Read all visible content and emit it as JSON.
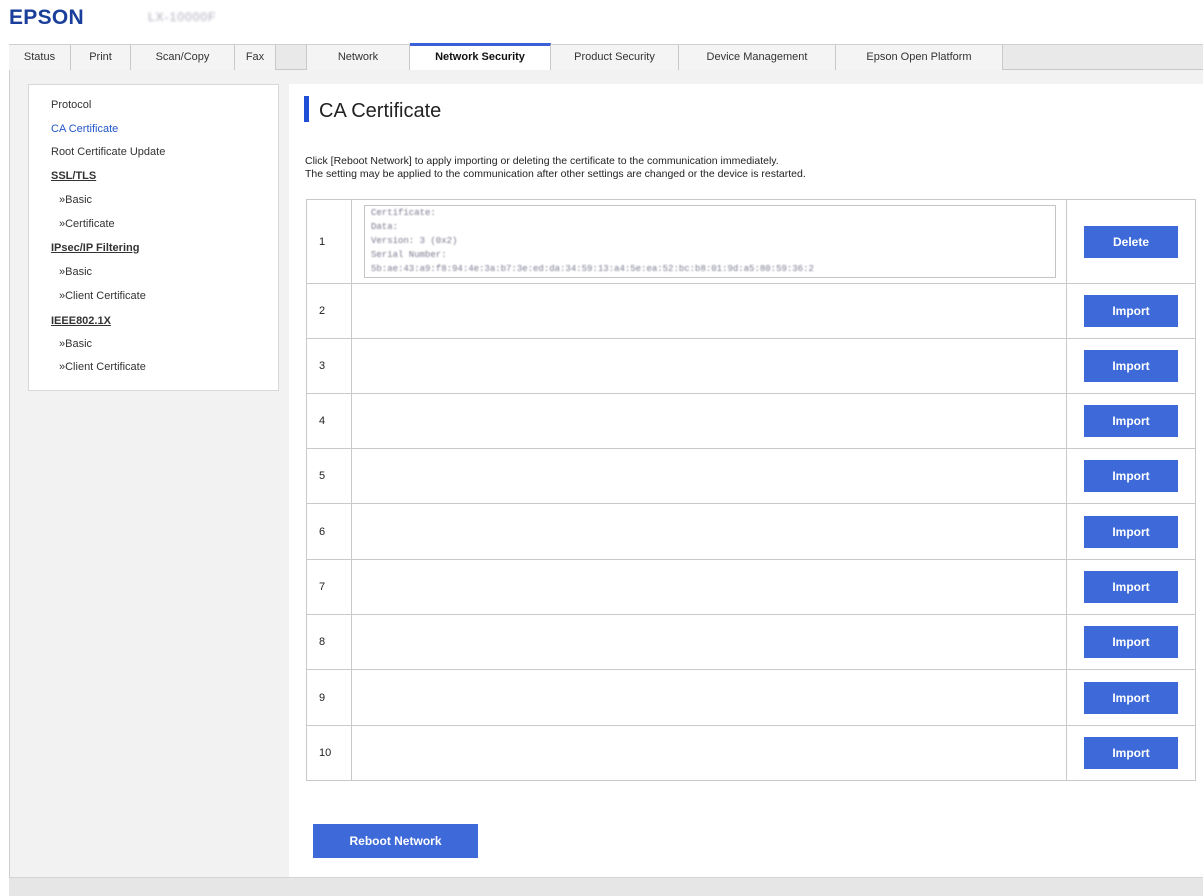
{
  "header": {
    "logo": "EPSON",
    "model": "LX-10000F"
  },
  "tabs": [
    {
      "label": "Status",
      "active": false
    },
    {
      "label": "Print",
      "active": false
    },
    {
      "label": "Scan/Copy",
      "active": false
    },
    {
      "label": "Fax",
      "active": false
    },
    {
      "label": "Network",
      "active": false
    },
    {
      "label": "Network Security",
      "active": true
    },
    {
      "label": "Product Security",
      "active": false
    },
    {
      "label": "Device Management",
      "active": false
    },
    {
      "label": "Epson Open Platform",
      "active": false
    }
  ],
  "sidebar": {
    "items": [
      {
        "label": "Protocol",
        "kind": "link"
      },
      {
        "label": "CA Certificate",
        "kind": "active"
      },
      {
        "label": "Root Certificate Update",
        "kind": "link"
      },
      {
        "label": "SSL/TLS",
        "kind": "section"
      },
      {
        "label": "»Basic",
        "kind": "sub"
      },
      {
        "label": "»Certificate",
        "kind": "sub"
      },
      {
        "label": "IPsec/IP Filtering",
        "kind": "section"
      },
      {
        "label": "»Basic",
        "kind": "sub"
      },
      {
        "label": "»Client Certificate",
        "kind": "sub"
      },
      {
        "label": "IEEE802.1X",
        "kind": "section"
      },
      {
        "label": "»Basic",
        "kind": "sub"
      },
      {
        "label": "»Client Certificate",
        "kind": "sub"
      }
    ]
  },
  "main": {
    "title": "CA Certificate",
    "description_1": "Click [Reboot Network] to apply importing or deleting the certificate to the communication immediately.",
    "description_2": "The setting may be applied to the communication after other settings are changed or the device is restarted.",
    "certificate_text": [
      "Certificate:",
      "    Data:",
      "        Version: 3 (0x2)",
      "        Serial Number:",
      "            5b:ae:43:a9:f8:94:4e:3a:b7:3e:ed:da:34:59:13:a4:5e:ea:52:bc:b8:01:9d:a5:80:59:36:2"
    ],
    "rows": [
      {
        "num": "1",
        "action": "Delete",
        "has_cert": true
      },
      {
        "num": "2",
        "action": "Import",
        "has_cert": false
      },
      {
        "num": "3",
        "action": "Import",
        "has_cert": false
      },
      {
        "num": "4",
        "action": "Import",
        "has_cert": false
      },
      {
        "num": "5",
        "action": "Import",
        "has_cert": false
      },
      {
        "num": "6",
        "action": "Import",
        "has_cert": false
      },
      {
        "num": "7",
        "action": "Import",
        "has_cert": false
      },
      {
        "num": "8",
        "action": "Import",
        "has_cert": false
      },
      {
        "num": "9",
        "action": "Import",
        "has_cert": false
      },
      {
        "num": "10",
        "action": "Import",
        "has_cert": false
      }
    ],
    "reboot_label": "Reboot Network"
  },
  "colors": {
    "accent": "#3d6ad8",
    "brand": "#1a3f9a",
    "active_link": "#2357c8"
  }
}
